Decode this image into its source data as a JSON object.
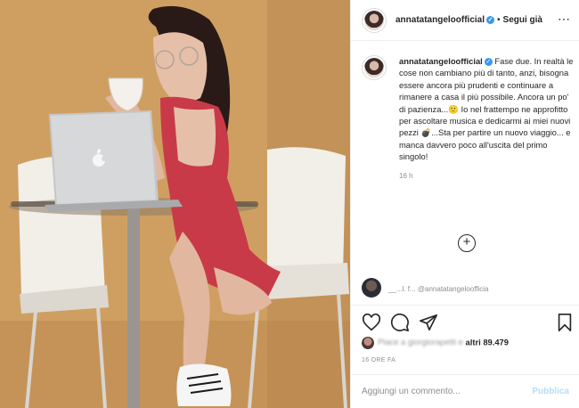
{
  "post": {
    "username": "annatatangeloofficial",
    "verified_badge": "✓",
    "separator": "•",
    "follow_state": "Segui già",
    "more_icon": "more-horizontal-icon",
    "caption": "Fase due. In realtà le cose non cambiano più di tanto, anzi, bisogna essere ancora più prudenti e continuare a rimanere a casa il più possibile. Ancora un po' di pazienza...🙂 Io nel frattempo ne approfitto per ascoltare musica e dedicarmi ai miei nuovi pezzi 💣...Sta per partire un nuovo viaggio... e manca davvero poco all'uscita del primo singolo!",
    "caption_time": "16 h",
    "load_more_icon": "plus-circle-icon",
    "comment_preview": "__...l. f... @annatatangeloofficia",
    "likes_prefix_blurred": "Piace a giorgiorapetti e",
    "likes_suffix": "altri 89.479",
    "date": "16 ORE FA",
    "add_comment_placeholder": "Aggiungi un commento...",
    "publish_label": "Pubblica"
  },
  "icons": [
    "heart-icon",
    "comment-icon",
    "share-icon",
    "bookmark-icon"
  ],
  "colors": {
    "link_blue": "#3897f0",
    "publish_disabled": "#b2dffc",
    "secondary_text": "#8e8e8e",
    "border": "#efefef"
  }
}
